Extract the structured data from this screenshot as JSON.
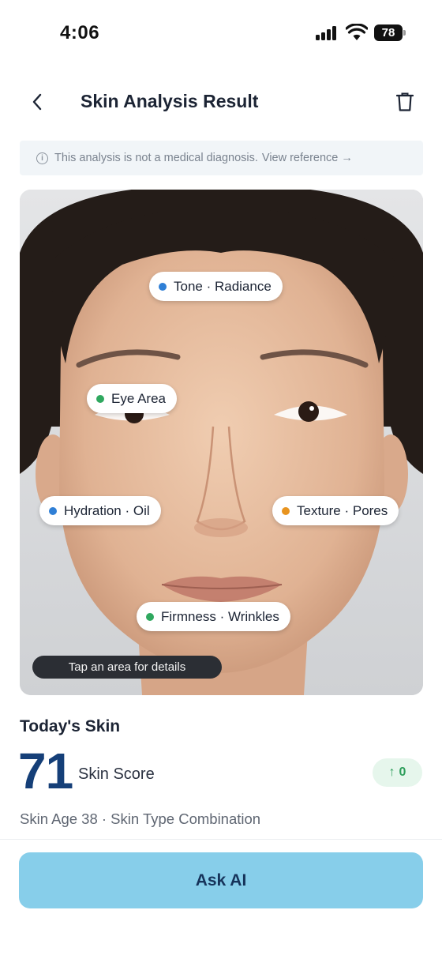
{
  "status_bar": {
    "time": "4:06",
    "battery": "78",
    "icons": [
      "signal-icon",
      "wifi-icon",
      "battery-icon"
    ]
  },
  "header": {
    "title": "Skin Analysis Result",
    "back_icon": "chevron-left-icon",
    "delete_icon": "trash-icon"
  },
  "disclaimer": {
    "text": "This analysis is not a medical diagnosis.",
    "link": "View reference →",
    "icon": "info-icon"
  },
  "face_areas": [
    {
      "label": "Tone · Radiance",
      "color": "#2f7fd6"
    },
    {
      "label": "Eye Area",
      "color": "#2fa85f"
    },
    {
      "label": "Hydration · Oil",
      "color": "#2f7fd6"
    },
    {
      "label": "Texture · Pores",
      "color": "#e8941f"
    },
    {
      "label": "Firmness · Wrinkles",
      "color": "#2fa85f"
    }
  ],
  "tap_hint": "Tap an area for details",
  "today": {
    "title": "Today's Skin",
    "score": "71",
    "score_label": "Skin Score",
    "change": "0",
    "change_direction": "up",
    "meta": "Skin Age 38 · Skin Type Combination"
  },
  "actions": {
    "ask_ai": "Ask AI"
  },
  "colors": {
    "accent": "#153f78",
    "button": "#87ceea",
    "positive": "#2e9e5b"
  }
}
